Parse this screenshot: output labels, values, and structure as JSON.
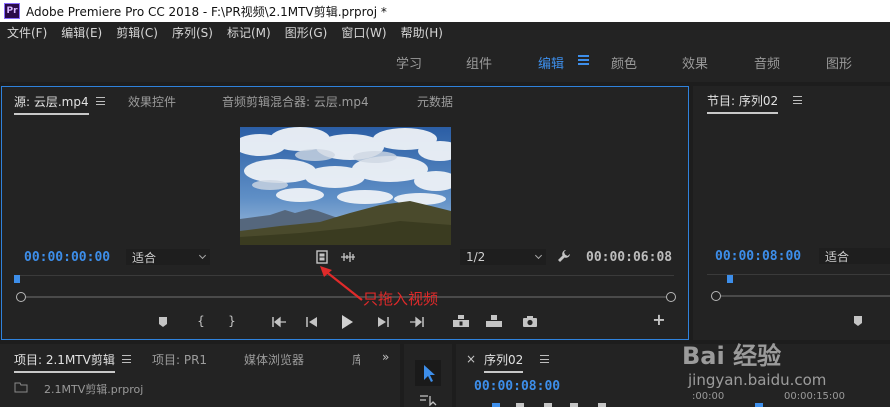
{
  "window": {
    "title": "Adobe Premiere Pro CC 2018 - F:\\PR视频\\2.1MTV剪辑.prproj *",
    "app_icon": "Pr"
  },
  "menu": [
    "文件(F)",
    "编辑(E)",
    "剪辑(C)",
    "序列(S)",
    "标记(M)",
    "图形(G)",
    "窗口(W)",
    "帮助(H)"
  ],
  "workspaces": {
    "tabs": [
      "学习",
      "组件",
      "编辑",
      "颜色",
      "效果",
      "音频",
      "图形"
    ],
    "active": "编辑"
  },
  "source_monitor": {
    "tabs": [
      "源: 云层.mp4",
      "效果控件",
      "音频剪辑混合器: 云层.mp4",
      "元数据"
    ],
    "timecode_in": "00:00:00:00",
    "zoom_select": "适合",
    "resolution_select": "1/2",
    "duration": "00:00:06:08",
    "video_only_icon": "film-icon",
    "audio_only_icon": "audio-waveform-icon"
  },
  "program_monitor": {
    "tab": "节目: 序列02",
    "timecode": "00:00:08:00",
    "zoom_select": "适合"
  },
  "project_panel": {
    "tabs": [
      "项目: 2.1MTV剪辑",
      "项目: PR1",
      "媒体浏览器",
      "库"
    ],
    "file": "2.1MTV剪辑.prproj"
  },
  "timeline_panel": {
    "tab": "序列02",
    "timecode": "00:00:08:00",
    "ruler": [
      ":00:00",
      "00:00:15:00"
    ]
  },
  "annotation": {
    "text": "只拖入视频",
    "color": "#e02a2a"
  },
  "watermark": {
    "brand": "Bai 经验",
    "url": "jingyan.baidu.com"
  },
  "colors": {
    "accent": "#3d8eea",
    "panel_bg": "#232323",
    "app_bg": "#1d1d1d"
  }
}
